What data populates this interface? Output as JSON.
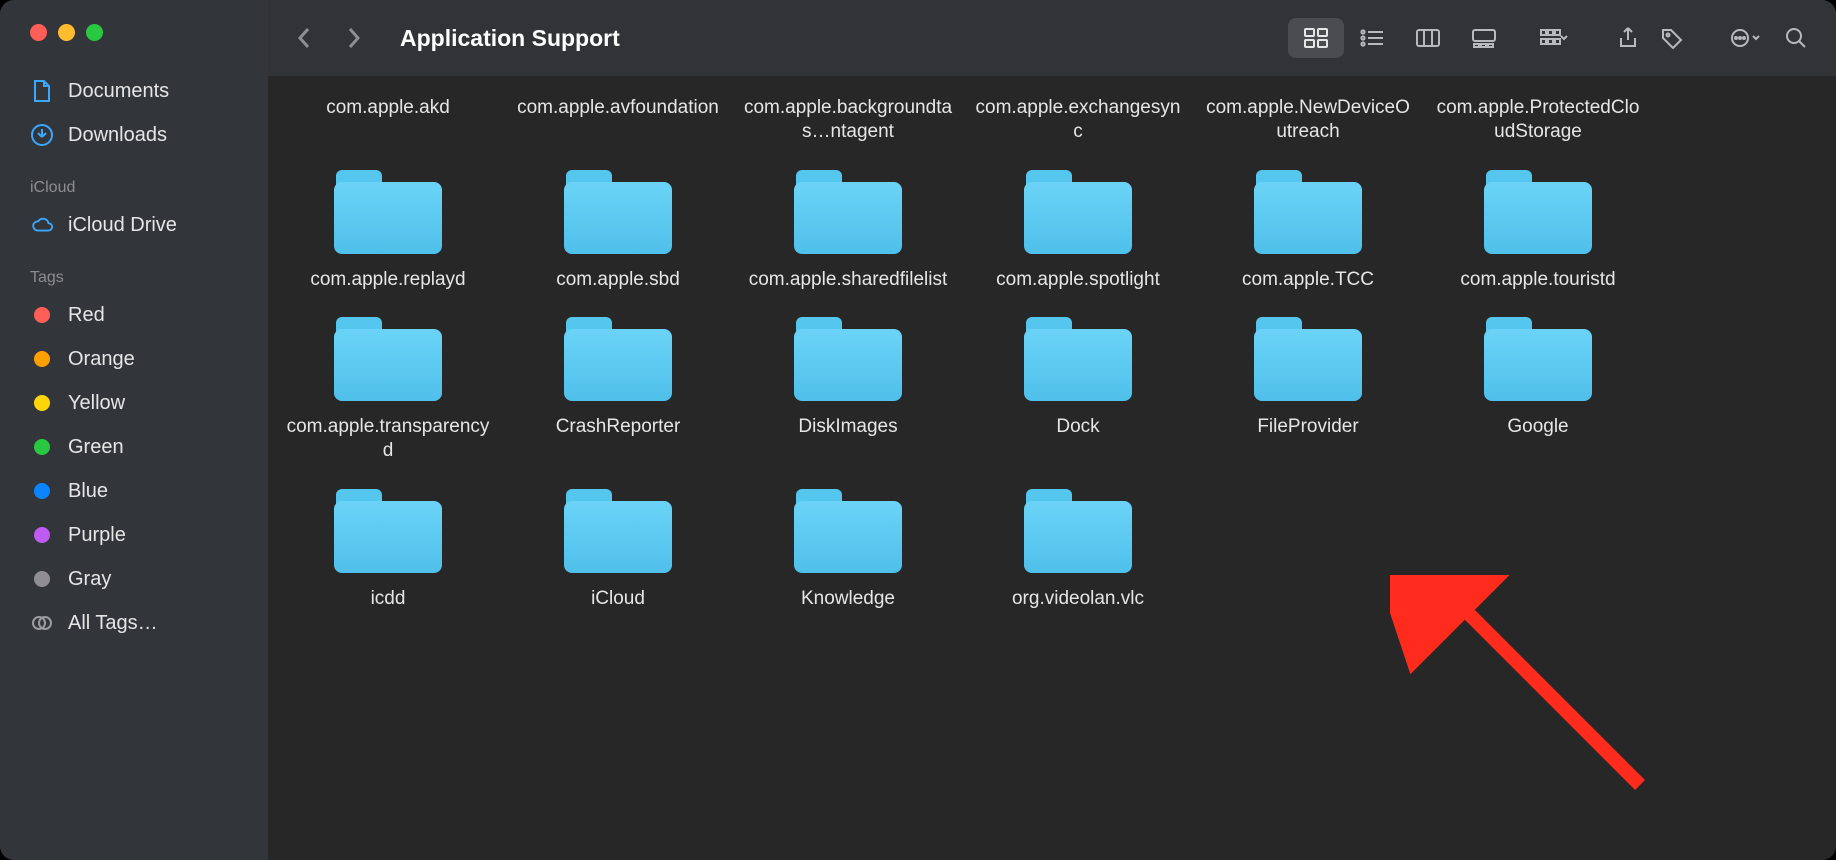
{
  "window": {
    "title": "Application Support"
  },
  "sidebar": {
    "favorites": [
      {
        "id": "documents",
        "label": "Documents"
      },
      {
        "id": "downloads",
        "label": "Downloads"
      }
    ],
    "sections": {
      "icloud": "iCloud",
      "tags": "Tags"
    },
    "icloud": [
      {
        "id": "icloud-drive",
        "label": "iCloud Drive"
      }
    ],
    "tags": [
      {
        "id": "red",
        "label": "Red"
      },
      {
        "id": "orange",
        "label": "Orange"
      },
      {
        "id": "yellow",
        "label": "Yellow"
      },
      {
        "id": "green",
        "label": "Green"
      },
      {
        "id": "blue",
        "label": "Blue"
      },
      {
        "id": "purple",
        "label": "Purple"
      },
      {
        "id": "gray",
        "label": "Gray"
      },
      {
        "id": "all",
        "label": "All Tags…"
      }
    ]
  },
  "items_label_only": [
    "com.apple.akd",
    "com.apple.avfoundation",
    "com.apple.backgroundtas…ntagent",
    "com.apple.exchangesync",
    "com.apple.NewDeviceOutreach",
    "com.apple.ProtectedCloudStorage"
  ],
  "items": [
    "com.apple.replayd",
    "com.apple.sbd",
    "com.apple.sharedfilelist",
    "com.apple.spotlight",
    "com.apple.TCC",
    "com.apple.touristd",
    "com.apple.transparencyd",
    "CrashReporter",
    "DiskImages",
    "Dock",
    "FileProvider",
    "Google",
    "icdd",
    "iCloud",
    "Knowledge",
    "org.videolan.vlc"
  ],
  "arrow_target": "Google"
}
